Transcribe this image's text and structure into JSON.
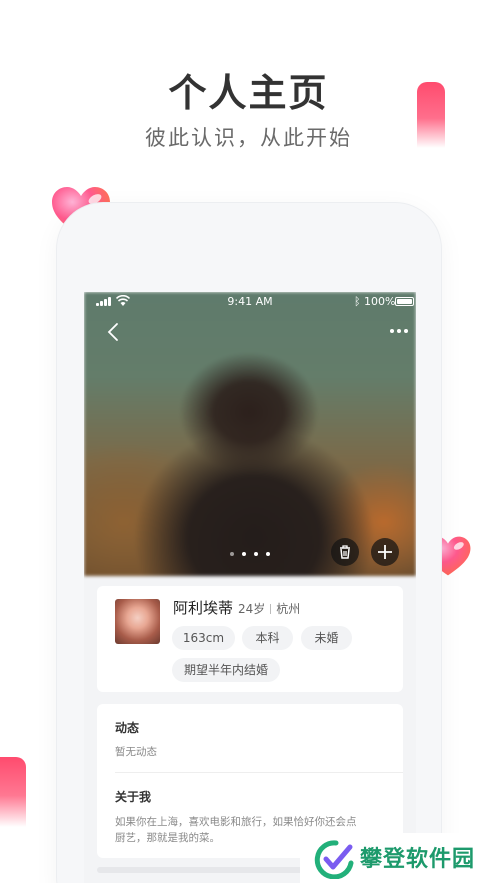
{
  "header": {
    "title": "个人主页",
    "subtitle": "彼此认识，从此开始"
  },
  "status_bar": {
    "time": "9:41 AM",
    "battery": "100%"
  },
  "photo": {
    "page_count": 4
  },
  "profile": {
    "name": "阿利埃蒂",
    "age": "24岁",
    "city": "杭州",
    "tags": [
      "163cm",
      "本科",
      "未婚",
      "期望半年内结婚"
    ]
  },
  "moments": {
    "title": "动态",
    "body": "暂无动态"
  },
  "about": {
    "title": "关于我",
    "line1": "如果你在上海，喜欢电影和旅行，如果恰好你还会点",
    "line2": "厨艺，那就是我的菜。"
  },
  "watermark": {
    "text": "攀登软件园"
  },
  "colors": {
    "accent_pink": "#ff4b6e",
    "watermark_green": "#1d9a6c"
  }
}
